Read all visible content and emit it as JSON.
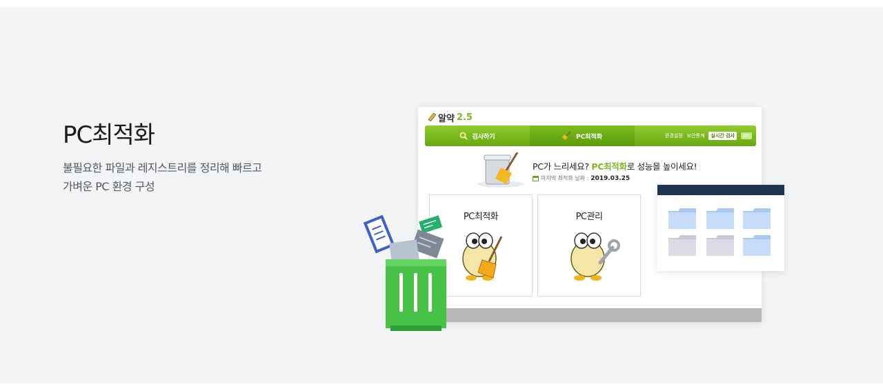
{
  "hero": {
    "title": "PC최적화",
    "description_lines": [
      "불필요한 파일과 레지스트리를 정리해 빠르고",
      "가벼운 PC 환경 구성"
    ]
  },
  "app": {
    "logo_name": "알약",
    "logo_version": "2.5",
    "tabs": {
      "scan": "검사하기",
      "optimize": "PC최적화"
    },
    "right_links": {
      "settings": "환경설정",
      "security_stats": "보안통계",
      "realtime": "실시간 검사",
      "realtime_state": "On"
    },
    "message": {
      "prefix": "PC가 느리세요? ",
      "highlight": "PC최적화",
      "suffix": "로 성능을 높이세요!"
    },
    "last_run": {
      "label": "마지막 최적화 날짜 :",
      "date": "2019.03.25"
    },
    "cards": [
      {
        "title": "PC최적화"
      },
      {
        "title": "PC관리"
      }
    ]
  },
  "colors": {
    "accent_green": "#7fb526",
    "tab_green": "#68a815",
    "trash_green": "#4fc64e",
    "folder_blue": "#b9d5f7",
    "folder_window_bar": "#1f3450",
    "background": "#f2f4f6"
  },
  "icons": [
    "pencil-icon",
    "search-icon",
    "broom-icon",
    "calendar-icon",
    "trash-can-icon",
    "folder-icon",
    "mascot-broom-icon",
    "mascot-wrench-icon",
    "cleaner-bucket-icon"
  ]
}
